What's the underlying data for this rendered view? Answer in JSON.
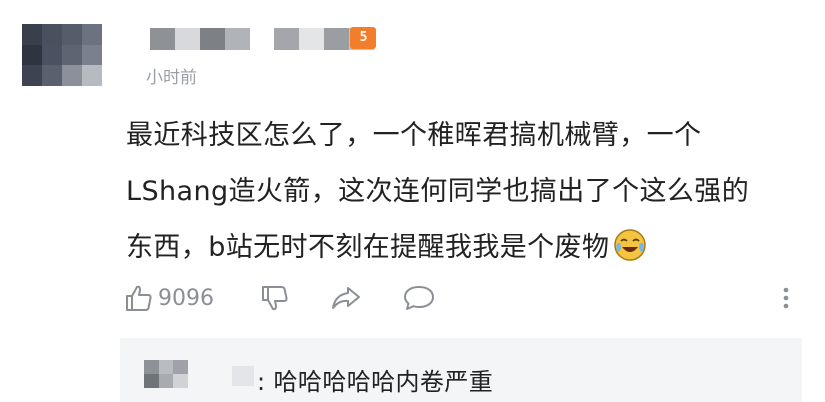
{
  "comment": {
    "timestamp": "小时前",
    "level_badge": "5",
    "lines": [
      "最近科技区怎么了，一个稚晖君搞机械臂，一个",
      "LShang造火箭，这次连何同学也搞出了个这么强的",
      "东西，b站无时不刻在提醒我我是个废物"
    ],
    "emoji": "laughing-crying-emoji"
  },
  "actions": {
    "like_count": "9096",
    "icons": [
      "thumbs-up-icon",
      "thumbs-down-icon",
      "share-icon",
      "comment-icon",
      "more-vertical-icon"
    ]
  },
  "reply": {
    "text": ": 哈哈哈哈哈内卷严重"
  },
  "colors": {
    "badge": "#f27d2b",
    "muted": "#9aa0a6",
    "text": "#222222",
    "reply_bg": "#f4f5f7"
  }
}
